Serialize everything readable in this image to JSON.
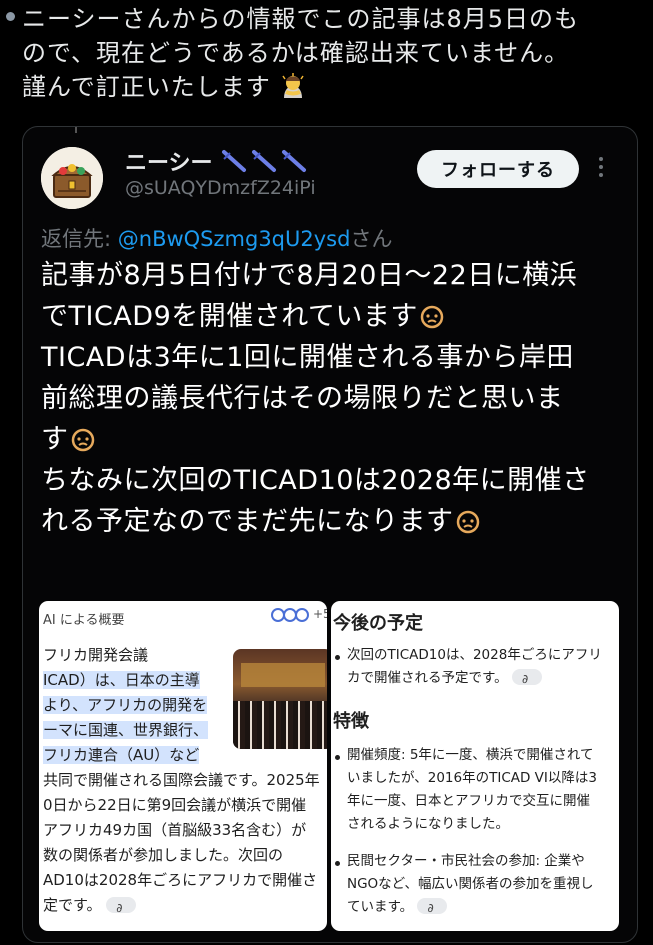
{
  "post": {
    "lines": [
      "ニーシーさんからの情報でこの記事は8月5日のも",
      "ので、現在どうであるかは確認出来ていません。",
      "謹んで訂正いたします"
    ]
  },
  "quote": {
    "name": "ニーシー",
    "handle": "@sUAQYDmzfZ24iPi",
    "follow_label": "フォローする",
    "reply_prefix": "返信先: ",
    "reply_handle": "@nBwQSzmg3qU2ysd",
    "reply_suffix": "さん",
    "body_lines": [
      "記事が8月5日付けで8月20日〜22日に横浜",
      "でTICAD9を開催されています",
      "TICADは3年に1回に開催される事から岸田",
      "前総理の議長代行はその場限りだと思いま",
      "す",
      "ちなみに次回のTICAD10は2028年に開催さ",
      "れる予定なのでまだ先になります"
    ]
  },
  "screenshot_left": {
    "title": "AI による概要",
    "count": "+5",
    "lines": [
      "フリカ開発会議",
      "ICAD）は、日本の主導",
      "より、アフリカの開発を",
      "ーマに国連、世界銀行、",
      "フリカ連合（AU）など",
      "共同で開催される国際会議です。2025年",
      "0日から22日に第9回会議が横浜で開催",
      "アフリカ49カ国（首脳級33名含む）が",
      "数の関係者が参加しました。次回の",
      "AD10は2028年ごろにアフリカで開催さ",
      "定です。"
    ]
  },
  "screenshot_right": {
    "heading1": "今後の予定",
    "lines1": [
      "次回のTICAD10は、2028年ごろにアフリ",
      "カで開催される予定です。"
    ],
    "heading2": "特徴",
    "lines2": [
      "開催頻度: 5年に一度、横浜で開催されて",
      "いましたが、2016年のTICAD VI以降は3",
      "年に一度、日本とアフリカで交互に開催",
      "されるようになりました。"
    ],
    "lines3": [
      "民間セクター・市民社会の参加: 企業や",
      "NGOなど、幅広い関係者の参加を重視し",
      "ています。"
    ]
  },
  "colors": {
    "link": "#1d9bf0",
    "muted": "#71767b",
    "badge": "#4c6fd8",
    "highlight": "#d3e3fd"
  },
  "icons": [
    "bowing-person-emoji",
    "treasure-chest-avatar",
    "syringe-emoji",
    "pleading-face-emoji",
    "link-chip-icon"
  ]
}
